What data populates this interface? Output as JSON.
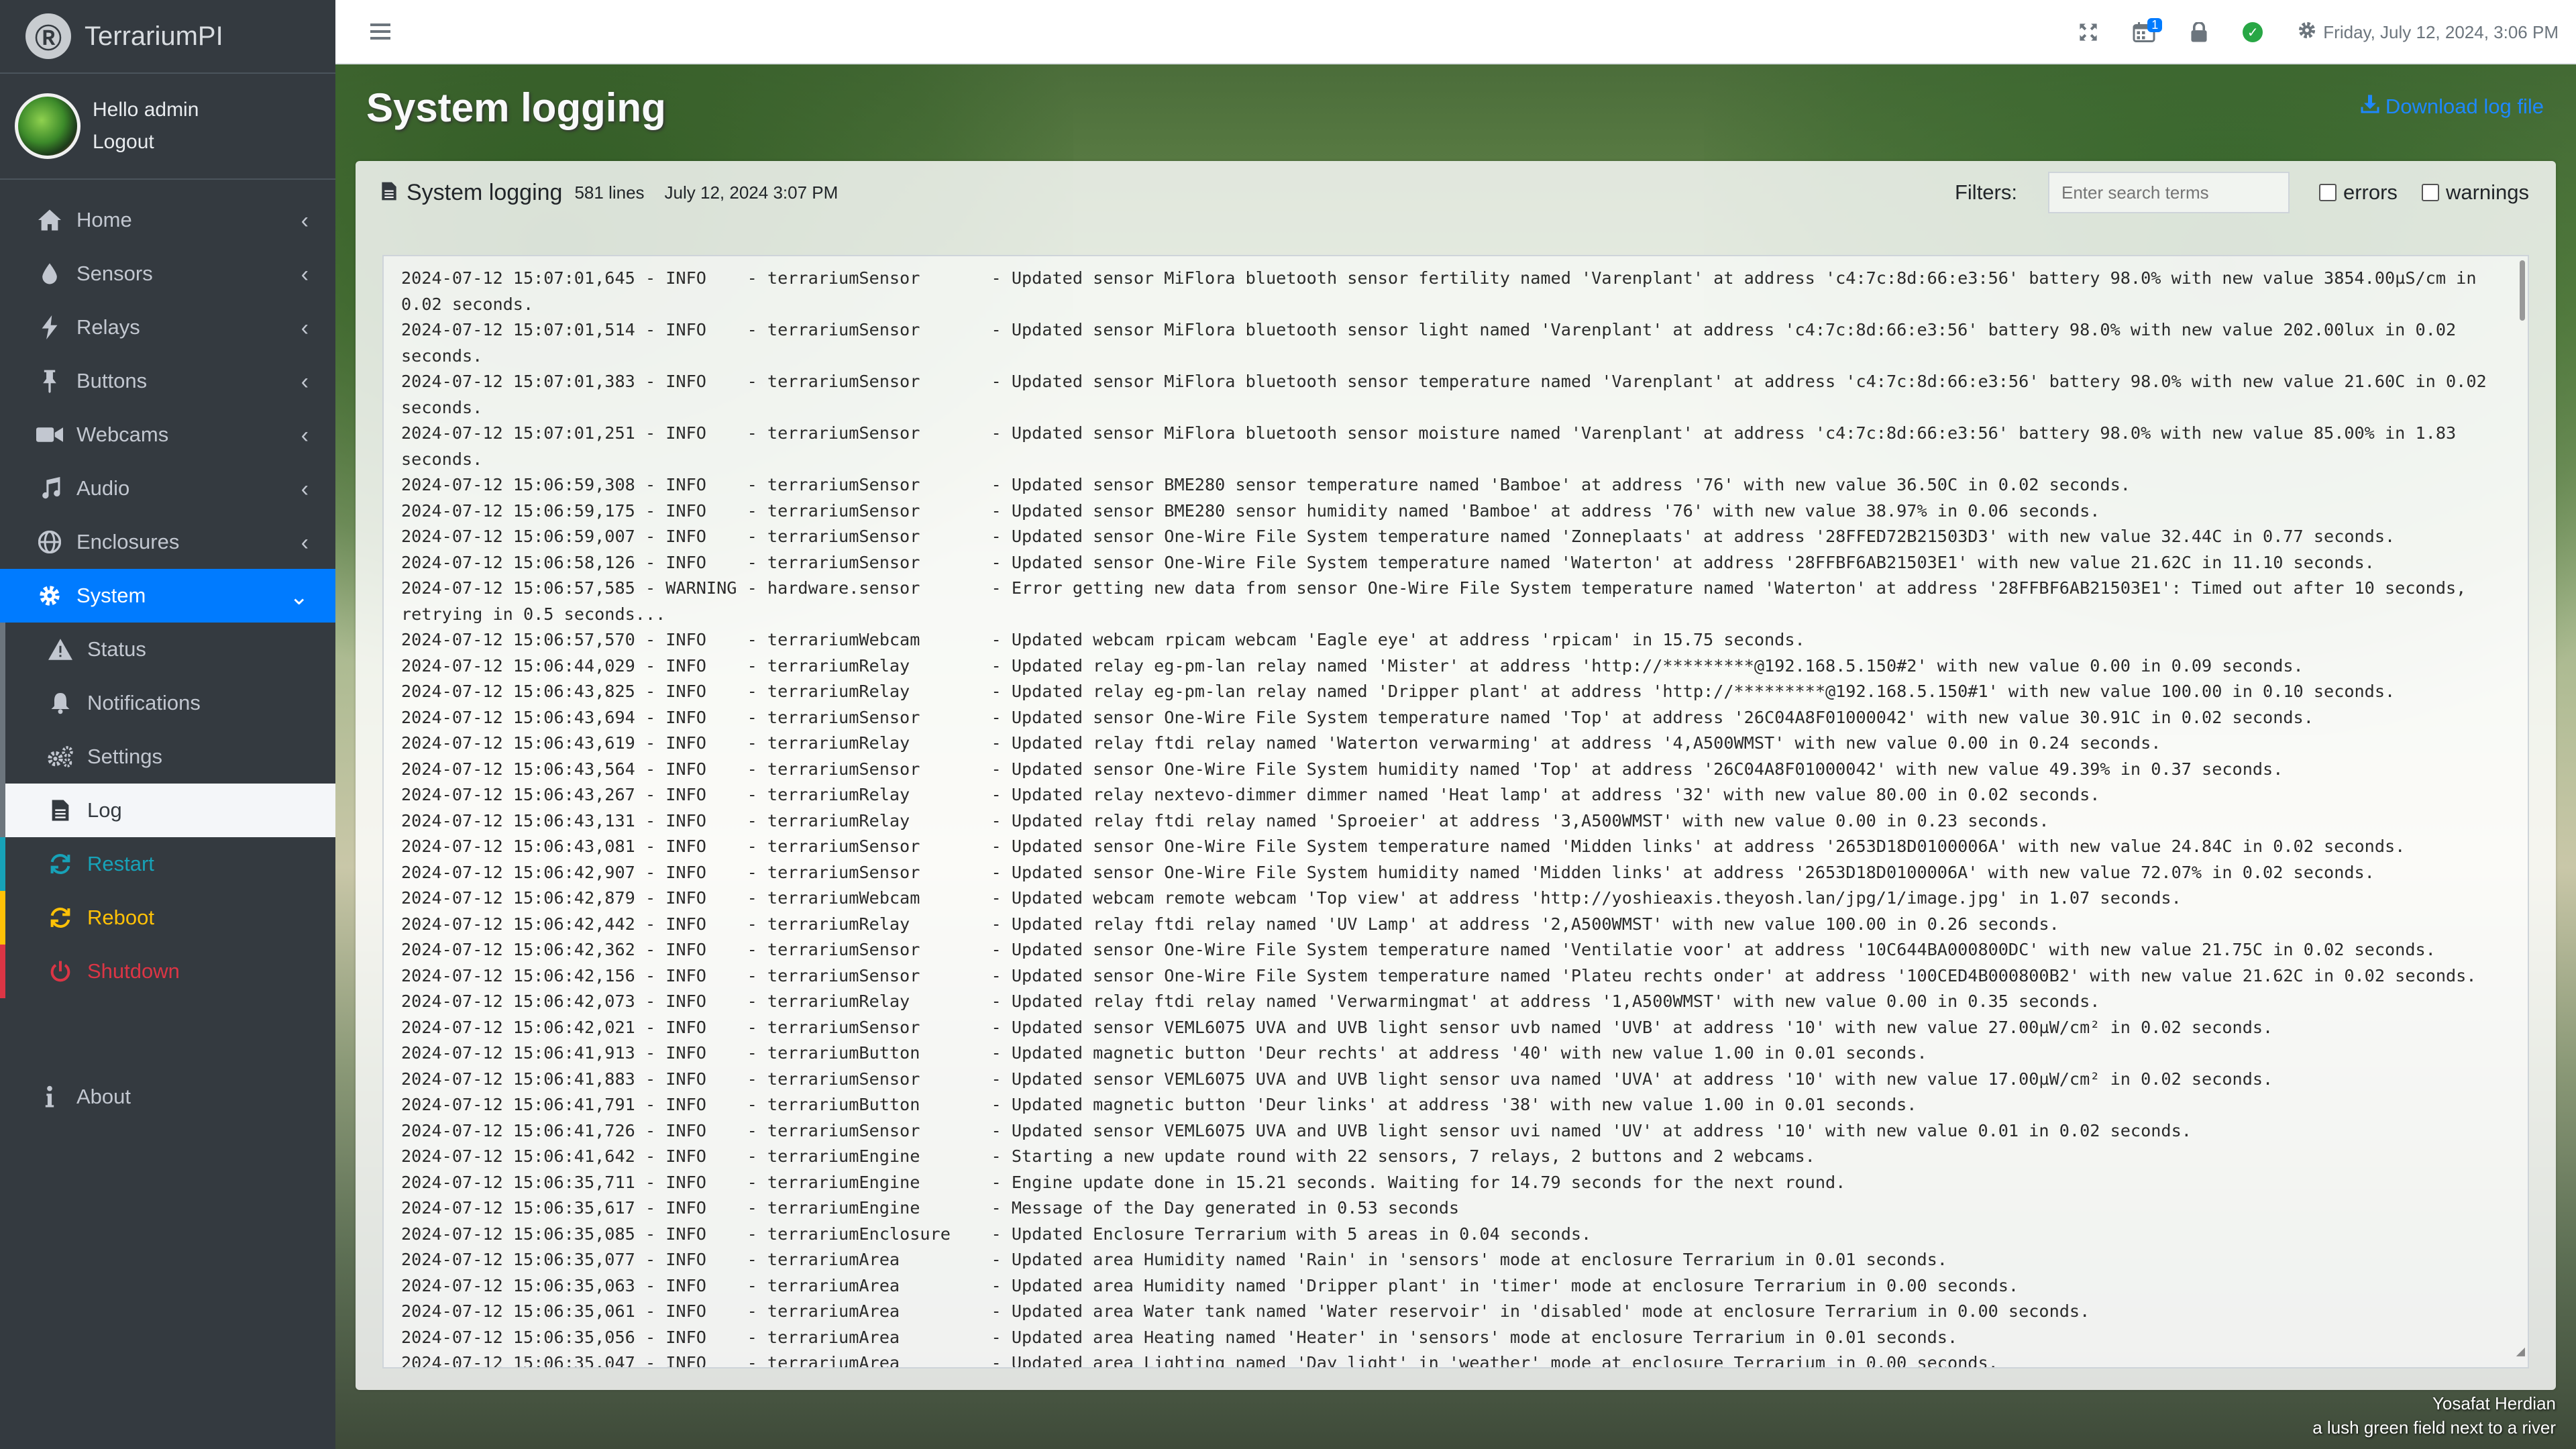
{
  "brand": {
    "name": "TerrariumPI"
  },
  "user": {
    "greeting": "Hello admin",
    "logout": "Logout"
  },
  "nav": {
    "items": [
      {
        "label": "Home",
        "icon": "home-icon"
      },
      {
        "label": "Sensors",
        "icon": "droplet-icon"
      },
      {
        "label": "Relays",
        "icon": "bolt-icon"
      },
      {
        "label": "Buttons",
        "icon": "push-pin-icon"
      },
      {
        "label": "Webcams",
        "icon": "video-camera-icon"
      },
      {
        "label": "Audio",
        "icon": "music-note-icon"
      },
      {
        "label": "Enclosures",
        "icon": "globe-icon"
      },
      {
        "label": "System",
        "icon": "gear-icon"
      }
    ],
    "system_sub": [
      {
        "label": "Status",
        "icon": "warning-triangle-icon"
      },
      {
        "label": "Notifications",
        "icon": "bell-icon"
      },
      {
        "label": "Settings",
        "icon": "gears-icon"
      },
      {
        "label": "Log",
        "icon": "file-icon"
      }
    ],
    "restart": "Restart",
    "reboot": "Reboot",
    "shutdown": "Shutdown",
    "about": "About"
  },
  "topbar": {
    "datetime": "Friday, July 12, 2024, 3:06 PM",
    "calendar_badge": "1"
  },
  "page": {
    "title": "System logging",
    "download": "Download log file"
  },
  "card": {
    "title": "System logging",
    "lines": "581 lines",
    "date": "July 12, 2024 3:07 PM",
    "filters_label": "Filters:",
    "search_placeholder": "Enter search terms",
    "errors_label": "errors",
    "warnings_label": "warnings"
  },
  "log": [
    "2024-07-12 15:07:01,645 - INFO    - terrariumSensor       - Updated sensor MiFlora bluetooth sensor fertility named 'Varenplant' at address 'c4:7c:8d:66:e3:56' battery 98.0% with new value 3854.00µS/cm in 0.02 seconds.",
    "2024-07-12 15:07:01,514 - INFO    - terrariumSensor       - Updated sensor MiFlora bluetooth sensor light named 'Varenplant' at address 'c4:7c:8d:66:e3:56' battery 98.0% with new value 202.00lux in 0.02 seconds.",
    "2024-07-12 15:07:01,383 - INFO    - terrariumSensor       - Updated sensor MiFlora bluetooth sensor temperature named 'Varenplant' at address 'c4:7c:8d:66:e3:56' battery 98.0% with new value 21.60C in 0.02 seconds.",
    "2024-07-12 15:07:01,251 - INFO    - terrariumSensor       - Updated sensor MiFlora bluetooth sensor moisture named 'Varenplant' at address 'c4:7c:8d:66:e3:56' battery 98.0% with new value 85.00% in 1.83 seconds.",
    "2024-07-12 15:06:59,308 - INFO    - terrariumSensor       - Updated sensor BME280 sensor temperature named 'Bamboe' at address '76' with new value 36.50C in 0.02 seconds.",
    "2024-07-12 15:06:59,175 - INFO    - terrariumSensor       - Updated sensor BME280 sensor humidity named 'Bamboe' at address '76' with new value 38.97% in 0.06 seconds.",
    "2024-07-12 15:06:59,007 - INFO    - terrariumSensor       - Updated sensor One-Wire File System temperature named 'Zonneplaats' at address '28FFED72B21503D3' with new value 32.44C in 0.77 seconds.",
    "2024-07-12 15:06:58,126 - INFO    - terrariumSensor       - Updated sensor One-Wire File System temperature named 'Waterton' at address '28FFBF6AB21503E1' with new value 21.62C in 11.10 seconds.",
    "2024-07-12 15:06:57,585 - WARNING - hardware.sensor       - Error getting new data from sensor One-Wire File System temperature named 'Waterton' at address '28FFBF6AB21503E1': Timed out after 10 seconds, retrying in 0.5 seconds...",
    "2024-07-12 15:06:57,570 - INFO    - terrariumWebcam       - Updated webcam rpicam webcam 'Eagle eye' at address 'rpicam' in 15.75 seconds.",
    "2024-07-12 15:06:44,029 - INFO    - terrariumRelay        - Updated relay eg-pm-lan relay named 'Mister' at address 'http://*********@192.168.5.150#2' with new value 0.00 in 0.09 seconds.",
    "2024-07-12 15:06:43,825 - INFO    - terrariumRelay        - Updated relay eg-pm-lan relay named 'Dripper plant' at address 'http://*********@192.168.5.150#1' with new value 100.00 in 0.10 seconds.",
    "2024-07-12 15:06:43,694 - INFO    - terrariumSensor       - Updated sensor One-Wire File System temperature named 'Top' at address '26C04A8F01000042' with new value 30.91C in 0.02 seconds.",
    "2024-07-12 15:06:43,619 - INFO    - terrariumRelay        - Updated relay ftdi relay named 'Waterton verwarming' at address '4,A500WMST' with new value 0.00 in 0.24 seconds.",
    "2024-07-12 15:06:43,564 - INFO    - terrariumSensor       - Updated sensor One-Wire File System humidity named 'Top' at address '26C04A8F01000042' with new value 49.39% in 0.37 seconds.",
    "2024-07-12 15:06:43,267 - INFO    - terrariumRelay        - Updated relay nextevo-dimmer dimmer named 'Heat lamp' at address '32' with new value 80.00 in 0.02 seconds.",
    "2024-07-12 15:06:43,131 - INFO    - terrariumRelay        - Updated relay ftdi relay named 'Sproeier' at address '3,A500WMST' with new value 0.00 in 0.23 seconds.",
    "2024-07-12 15:06:43,081 - INFO    - terrariumSensor       - Updated sensor One-Wire File System temperature named 'Midden links' at address '2653D18D0100006A' with new value 24.84C in 0.02 seconds.",
    "2024-07-12 15:06:42,907 - INFO    - terrariumSensor       - Updated sensor One-Wire File System humidity named 'Midden links' at address '2653D18D0100006A' with new value 72.07% in 0.02 seconds.",
    "2024-07-12 15:06:42,879 - INFO    - terrariumWebcam       - Updated webcam remote webcam 'Top view' at address 'http://yoshieaxis.theyosh.lan/jpg/1/image.jpg' in 1.07 seconds.",
    "2024-07-12 15:06:42,442 - INFO    - terrariumRelay        - Updated relay ftdi relay named 'UV Lamp' at address '2,A500WMST' with new value 100.00 in 0.26 seconds.",
    "2024-07-12 15:06:42,362 - INFO    - terrariumSensor       - Updated sensor One-Wire File System temperature named 'Ventilatie voor' at address '10C644BA000800DC' with new value 21.75C in 0.02 seconds.",
    "2024-07-12 15:06:42,156 - INFO    - terrariumSensor       - Updated sensor One-Wire File System temperature named 'Plateu rechts onder' at address '100CED4B000800B2' with new value 21.62C in 0.02 seconds.",
    "2024-07-12 15:06:42,073 - INFO    - terrariumRelay        - Updated relay ftdi relay named 'Verwarmingmat' at address '1,A500WMST' with new value 0.00 in 0.35 seconds.",
    "2024-07-12 15:06:42,021 - INFO    - terrariumSensor       - Updated sensor VEML6075 UVA and UVB light sensor uvb named 'UVB' at address '10' with new value 27.00µW/cm² in 0.02 seconds.",
    "2024-07-12 15:06:41,913 - INFO    - terrariumButton       - Updated magnetic button 'Deur rechts' at address '40' with new value 1.00 in 0.01 seconds.",
    "2024-07-12 15:06:41,883 - INFO    - terrariumSensor       - Updated sensor VEML6075 UVA and UVB light sensor uva named 'UVA' at address '10' with new value 17.00µW/cm² in 0.02 seconds.",
    "2024-07-12 15:06:41,791 - INFO    - terrariumButton       - Updated magnetic button 'Deur links' at address '38' with new value 1.00 in 0.01 seconds.",
    "2024-07-12 15:06:41,726 - INFO    - terrariumSensor       - Updated sensor VEML6075 UVA and UVB light sensor uvi named 'UV' at address '10' with new value 0.01 in 0.02 seconds.",
    "2024-07-12 15:06:41,642 - INFO    - terrariumEngine       - Starting a new update round with 22 sensors, 7 relays, 2 buttons and 2 webcams.",
    "2024-07-12 15:06:35,711 - INFO    - terrariumEngine       - Engine update done in 15.21 seconds. Waiting for 14.79 seconds for the next round.",
    "2024-07-12 15:06:35,617 - INFO    - terrariumEngine       - Message of the Day generated in 0.53 seconds",
    "2024-07-12 15:06:35,085 - INFO    - terrariumEnclosure    - Updated Enclosure Terrarium with 5 areas in 0.04 seconds.",
    "2024-07-12 15:06:35,077 - INFO    - terrariumArea         - Updated area Humidity named 'Rain' in 'sensors' mode at enclosure Terrarium in 0.01 seconds.",
    "2024-07-12 15:06:35,063 - INFO    - terrariumArea         - Updated area Humidity named 'Dripper plant' in 'timer' mode at enclosure Terrarium in 0.00 seconds.",
    "2024-07-12 15:06:35,061 - INFO    - terrariumArea         - Updated area Water tank named 'Water reservoir' in 'disabled' mode at enclosure Terrarium in 0.00 seconds.",
    "2024-07-12 15:06:35,056 - INFO    - terrariumArea         - Updated area Heating named 'Heater' in 'sensors' mode at enclosure Terrarium in 0.01 seconds.",
    "2024-07-12 15:06:35,047 - INFO    - terrariumArea         - Updated area Lighting named 'Day light' in 'weather' mode at enclosure Terrarium in 0.00 seconds."
  ],
  "credit": {
    "author": "Yosafat Herdian",
    "caption": "a lush green field next to a river"
  }
}
